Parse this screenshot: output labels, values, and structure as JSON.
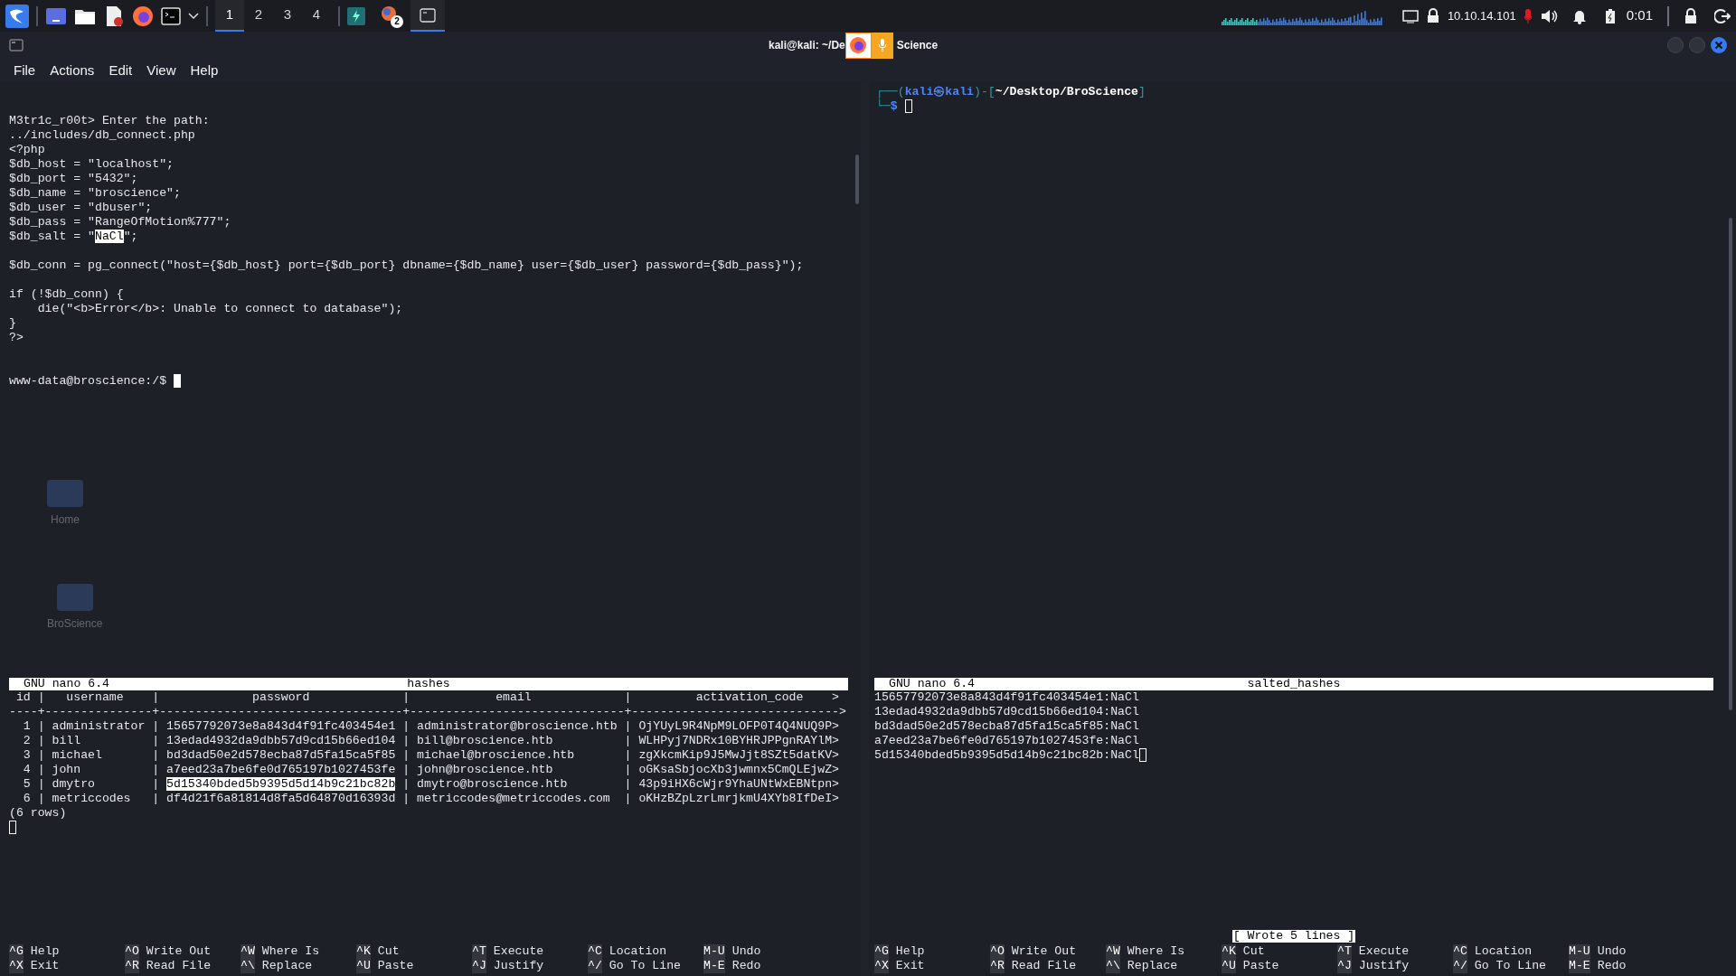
{
  "taskbar": {
    "workspaces": [
      {
        "label": "1",
        "selected": true
      },
      {
        "label": "2",
        "selected": false
      },
      {
        "label": "3",
        "selected": false
      },
      {
        "label": "4",
        "selected": false
      }
    ],
    "badge": "2",
    "ip": "10.10.14.101",
    "clock": "0:01"
  },
  "desktop_icons": [
    {
      "label": "Home"
    },
    {
      "label": "BroScience"
    }
  ],
  "window": {
    "title_left": "kali@kali: ~/De",
    "title_right": "Science",
    "menu": [
      "File",
      "Actions",
      "Edit",
      "View",
      "Help"
    ]
  },
  "shell_pane": {
    "focused": true,
    "blocks": [
      [
        {
          "segments": [
            {
              "text": "M3tr1c_r00t> Enter the path:",
              "kind": "plain"
            }
          ]
        },
        {
          "segments": [
            {
              "text": "../includes/db_connect.php",
              "kind": "plain"
            }
          ]
        },
        {
          "segments": [
            {
              "text": "<?php",
              "kind": "plain"
            }
          ]
        },
        {
          "segments": [
            {
              "text": "$db_host = \"localhost\";",
              "kind": "plain"
            }
          ]
        },
        {
          "segments": [
            {
              "text": "$db_port = \"5432\";",
              "kind": "plain"
            }
          ]
        },
        {
          "segments": [
            {
              "text": "$db_name = \"broscience\";",
              "kind": "plain"
            }
          ]
        },
        {
          "segments": [
            {
              "text": "$db_user = \"dbuser\";",
              "kind": "plain"
            }
          ]
        },
        {
          "segments": [
            {
              "text": "$db_pass = \"RangeOfMotion%777\";",
              "kind": "plain"
            }
          ]
        },
        {
          "segments": [
            {
              "text": "$db_salt = \"",
              "kind": "plain"
            },
            {
              "text": "NaCl",
              "kind": "selection"
            },
            {
              "text": "\";",
              "kind": "plain"
            }
          ]
        }
      ],
      [
        {
          "segments": [
            {
              "text": "$db_conn = pg_connect(\"host={$db_host} port={$db_port} dbname={$db_name} user={$db_user} password={$db_pass}\");",
              "kind": "plain"
            }
          ]
        }
      ],
      [
        {
          "segments": [
            {
              "text": "if (!$db_conn) {",
              "kind": "plain"
            }
          ]
        },
        {
          "segments": [
            {
              "text": "    die(\"<b>Error</b>: Unable to connect to database\");",
              "kind": "plain"
            }
          ]
        },
        {
          "segments": [
            {
              "text": "}",
              "kind": "plain"
            }
          ]
        },
        {
          "segments": [
            {
              "text": "?>",
              "kind": "plain"
            }
          ]
        }
      ]
    ],
    "prompt_line": {
      "segments": [
        {
          "text": "www-data@broscience:/$ ",
          "kind": "plain"
        }
      ],
      "cursor": true
    }
  },
  "prompt_pane": {
    "focused": false,
    "lines": [
      {
        "segments": [
          {
            "text": "┌──(",
            "kind": "frame"
          },
          {
            "text": "kali㉿kali",
            "kind": "user"
          },
          {
            "text": ")-[",
            "kind": "frame"
          },
          {
            "text": "~/Desktop/BroScience",
            "kind": "path"
          },
          {
            "text": "]",
            "kind": "frame"
          }
        ]
      },
      {
        "segments": [
          {
            "text": "└─",
            "kind": "frame"
          },
          {
            "text": "$ ",
            "kind": "user"
          }
        ],
        "cursor": true
      }
    ]
  },
  "nano_panes": [
    {
      "focused": false,
      "version": "GNU nano 6.4",
      "file": "hashes",
      "lines": [
        {
          "segments": [
            {
              "text": " id |   username    |             password             |            email             |         activation_code    >",
              "kind": "plain"
            }
          ]
        },
        {
          "segments": [
            {
              "text": "----+---------------+----------------------------------+------------------------------+----------------------------->",
              "kind": "plain"
            }
          ]
        },
        {
          "segments": [
            {
              "text": "  1 | administrator | 15657792073e8a843d4f91fc403454e1 | administrator@broscience.htb | OjYUyL9R4NpM9LOFP0T4Q4NUQ9P>",
              "kind": "plain"
            }
          ]
        },
        {
          "segments": [
            {
              "text": "  2 | bill          | 13edad4932da9dbb57d9cd15b66ed104 | bill@broscience.htb          | WLHPyj7NDRx10BYHRJPPgnRAYlM>",
              "kind": "plain"
            }
          ]
        },
        {
          "segments": [
            {
              "text": "  3 | michael       | bd3dad50e2d578ecba87d5fa15ca5f85 | michael@broscience.htb       | zgXkcmKip9J5MwJjt8SZt5datKV>",
              "kind": "plain"
            }
          ]
        },
        {
          "segments": [
            {
              "text": "  4 | john          | a7eed23a7be6fe0d765197b1027453fe | john@broscience.htb          | oGKsaSbjocXb3jwmnx5CmQLEjwZ>",
              "kind": "plain"
            }
          ]
        },
        {
          "segments": [
            {
              "text": "  5 | dmytro        | ",
              "kind": "plain"
            },
            {
              "text": "5d15340bded5b9395d5d14b9c21bc82b",
              "kind": "selection"
            },
            {
              "text": " | dmytro@broscience.htb        | 43p9iHX6cWjr9YhaUNtWxEBNtpn>",
              "kind": "plain"
            }
          ]
        },
        {
          "segments": [
            {
              "text": "  6 | metriccodes   | df4d21f6a81814d8fa5d64870d16393d | metriccodes@metriccodes.com  | oKHzBZpLzrLmrjkmU4XYb8IfDeI>",
              "kind": "plain"
            }
          ]
        },
        {
          "segments": [
            {
              "text": "(6 rows)",
              "kind": "plain"
            }
          ]
        },
        {
          "cursor": true
        }
      ],
      "shortcuts": [
        [
          {
            "key": "^G",
            "label": "Help"
          },
          {
            "key": "^O",
            "label": "Write Out"
          },
          {
            "key": "^W",
            "label": "Where Is"
          },
          {
            "key": "^K",
            "label": "Cut"
          },
          {
            "key": "^T",
            "label": "Execute"
          },
          {
            "key": "^C",
            "label": "Location"
          },
          {
            "key": "M-U",
            "label": "Undo"
          }
        ],
        [
          {
            "key": "^X",
            "label": "Exit"
          },
          {
            "key": "^R",
            "label": "Read File"
          },
          {
            "key": "^\\",
            "label": "Replace"
          },
          {
            "key": "^U",
            "label": "Paste"
          },
          {
            "key": "^J",
            "label": "Justify"
          },
          {
            "key": "^/",
            "label": "Go To Line"
          },
          {
            "key": "M-E",
            "label": "Redo"
          }
        ]
      ]
    },
    {
      "focused": false,
      "version": "GNU nano 6.4",
      "file": "salted_hashes",
      "status": "[ Wrote 5 lines ]",
      "lines": [
        {
          "segments": [
            {
              "text": "15657792073e8a843d4f91fc403454e1:NaCl",
              "kind": "plain"
            }
          ]
        },
        {
          "segments": [
            {
              "text": "13edad4932da9dbb57d9cd15b66ed104:NaCl",
              "kind": "plain"
            }
          ]
        },
        {
          "segments": [
            {
              "text": "bd3dad50e2d578ecba87d5fa15ca5f85:NaCl",
              "kind": "plain"
            }
          ]
        },
        {
          "segments": [
            {
              "text": "a7eed23a7be6fe0d765197b1027453fe:NaCl",
              "kind": "plain"
            }
          ]
        },
        {
          "segments": [
            {
              "text": "5d15340bded5b9395d5d14b9c21bc82b:NaCl",
              "kind": "plain"
            }
          ],
          "cursor": true
        }
      ],
      "shortcuts": [
        [
          {
            "key": "^G",
            "label": "Help"
          },
          {
            "key": "^O",
            "label": "Write Out"
          },
          {
            "key": "^W",
            "label": "Where Is"
          },
          {
            "key": "^K",
            "label": "Cut"
          },
          {
            "key": "^T",
            "label": "Execute"
          },
          {
            "key": "^C",
            "label": "Location"
          },
          {
            "key": "M-U",
            "label": "Undo"
          }
        ],
        [
          {
            "key": "^X",
            "label": "Exit"
          },
          {
            "key": "^R",
            "label": "Read File"
          },
          {
            "key": "^\\",
            "label": "Replace"
          },
          {
            "key": "^U",
            "label": "Paste"
          },
          {
            "key": "^J",
            "label": "Justify"
          },
          {
            "key": "^/",
            "label": "Go To Line"
          },
          {
            "key": "M-E",
            "label": "Redo"
          }
        ]
      ]
    }
  ]
}
